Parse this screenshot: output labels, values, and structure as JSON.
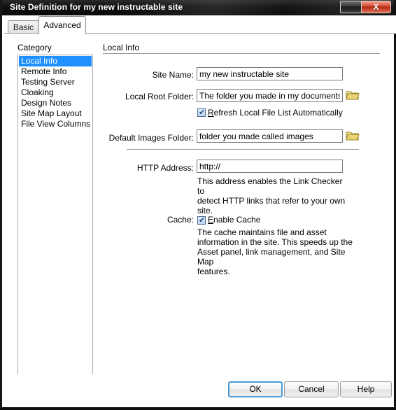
{
  "window": {
    "title": "Site Definition for my new instructable site",
    "close_glyph": "X",
    "minmax_name": "restore-button"
  },
  "tabs": [
    {
      "label": "Basic",
      "active": false
    },
    {
      "label": "Advanced",
      "active": true
    }
  ],
  "category": {
    "label": "Category",
    "items": [
      {
        "label": "Local Info",
        "selected": true
      },
      {
        "label": "Remote Info",
        "selected": false
      },
      {
        "label": "Testing Server",
        "selected": false
      },
      {
        "label": "Cloaking",
        "selected": false
      },
      {
        "label": "Design Notes",
        "selected": false
      },
      {
        "label": "Site Map Layout",
        "selected": false
      },
      {
        "label": "File View Columns",
        "selected": false
      }
    ]
  },
  "section": {
    "title": "Local Info"
  },
  "fields": {
    "site_name": {
      "label": "Site Name:",
      "value": "my new instructable site"
    },
    "local_root_folder": {
      "label": "Local Root Folder:",
      "value": "The folder you made in my documents",
      "browse_icon": "folder-icon"
    },
    "refresh_local": {
      "label_pre": "R",
      "label_post": "efresh Local File List Automatically",
      "checked": true,
      "check_glyph": "✔"
    },
    "default_images_folder": {
      "label": "Default Images Folder:",
      "value": "folder you made called images",
      "browse_icon": "folder-icon"
    },
    "http_address": {
      "label": "HTTP Address:",
      "value": "http://",
      "help": "This address enables the Link Checker to\ndetect HTTP links that refer to your own\nsite."
    },
    "cache": {
      "label": "Cache:",
      "check_label_pre": "E",
      "check_label_post": "nable Cache",
      "checked": true,
      "check_glyph": "✔",
      "help": "The cache maintains file and asset\ninformation in the site.  This speeds up the\nAsset panel, link management, and Site Map\nfeatures."
    }
  },
  "buttons": {
    "ok": "OK",
    "cancel": "Cancel",
    "help": "Help"
  },
  "colors": {
    "selection": "#1e90ff",
    "titlebar": "#101010",
    "close_button": "#c2301c",
    "folder": "#e8d48a",
    "default_button_border": "#4a9bd4"
  }
}
